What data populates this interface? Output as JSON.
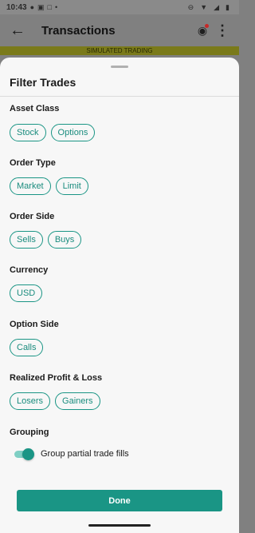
{
  "status_bar": {
    "time": "10:43",
    "left_icons": [
      "location-icon",
      "sim-icon",
      "notification-icon",
      "dot-icon"
    ],
    "right_icons": [
      "dnd-icon",
      "wifi-icon",
      "signal-icon",
      "battery-icon"
    ]
  },
  "header": {
    "title": "Transactions",
    "back_icon": "arrow-left-icon",
    "notification_icon": "bell-icon",
    "more_icon": "more-vertical-icon"
  },
  "banner": {
    "text": "SIMULATED TRADING"
  },
  "sheet": {
    "title": "Filter Trades",
    "sections": [
      {
        "label": "Asset Class",
        "chips": [
          "Stock",
          "Options"
        ]
      },
      {
        "label": "Order Type",
        "chips": [
          "Market",
          "Limit"
        ]
      },
      {
        "label": "Order Side",
        "chips": [
          "Sells",
          "Buys"
        ]
      },
      {
        "label": "Currency",
        "chips": [
          "USD"
        ]
      },
      {
        "label": "Option Side",
        "chips": [
          "Calls"
        ]
      },
      {
        "label": "Realized Profit & Loss",
        "chips": [
          "Losers",
          "Gainers"
        ]
      }
    ],
    "grouping": {
      "label": "Grouping",
      "toggle_label": "Group partial trade fills",
      "toggle_on": true
    },
    "done_label": "Done"
  },
  "colors": {
    "accent": "#1a9585",
    "sheet_background": "#f7f7f7",
    "overlay": "#808080"
  }
}
